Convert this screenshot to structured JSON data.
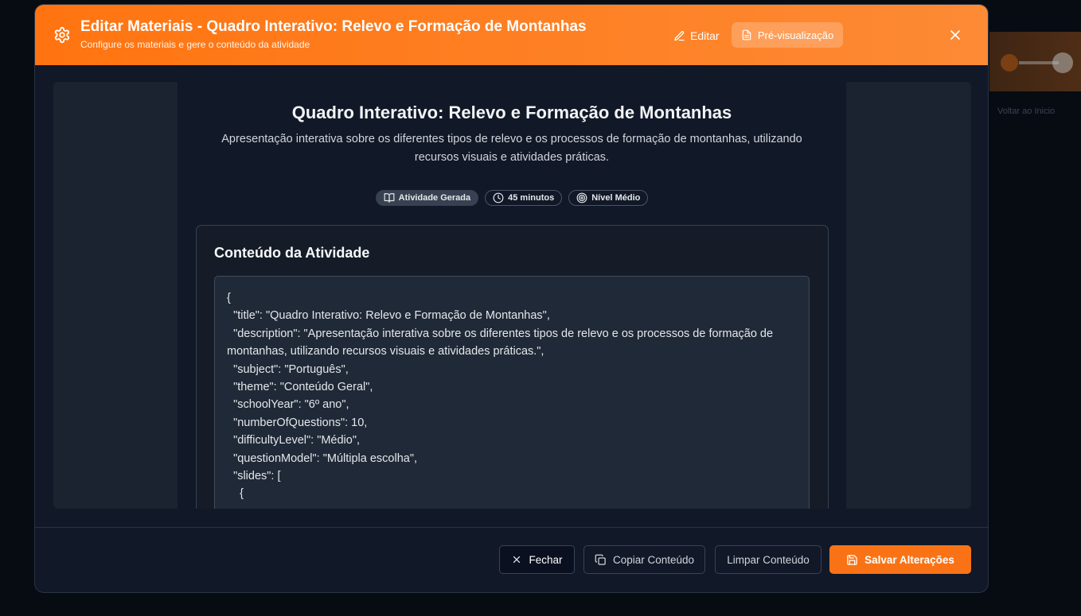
{
  "background": {
    "ghost_text": "Voltar ao Inicio"
  },
  "header": {
    "title": "Editar Materiais - Quadro Interativo: Relevo e Formação de Montanhas",
    "subtitle": "Configure os materiais e gere o conteúdo da atividade",
    "edit_label": "Editar",
    "preview_label": "Pré-visualização",
    "accent_color": "#ff7410"
  },
  "document": {
    "title": "Quadro Interativo: Relevo e Formação de Montanhas",
    "description": "Apresentação interativa sobre os diferentes tipos de relevo e os processos de formação de montanhas, utilizando recursos visuais e atividades práticas.",
    "badges": [
      {
        "label": "Atividade Gerada",
        "icon": "book-icon"
      },
      {
        "label": "45 minutos",
        "icon": "clock-icon"
      },
      {
        "label": "Nível Médio",
        "icon": "target-icon"
      }
    ],
    "content_card": {
      "title": "Conteúdo da Atividade",
      "editor_text": "{\n  \"title\": \"Quadro Interativo: Relevo e Formação de Montanhas\",\n  \"description\": \"Apresentação interativa sobre os diferentes tipos de relevo e os processos de formação de montanhas, utilizando recursos visuais e atividades práticas.\",\n  \"subject\": \"Português\",\n  \"theme\": \"Conteúdo Geral\",\n  \"schoolYear\": \"6º ano\",\n  \"numberOfQuestions\": 10,\n  \"difficultyLevel\": \"Médio\",\n  \"questionModel\": \"Múltipla escolha\",\n  \"slides\": [\n    {"
    }
  },
  "footer": {
    "close_label": "Fechar",
    "copy_label": "Copiar Conteúdo",
    "clear_label": "Limpar Conteúdo",
    "save_label": "Salvar Alterações",
    "save_color": "#f97316"
  }
}
